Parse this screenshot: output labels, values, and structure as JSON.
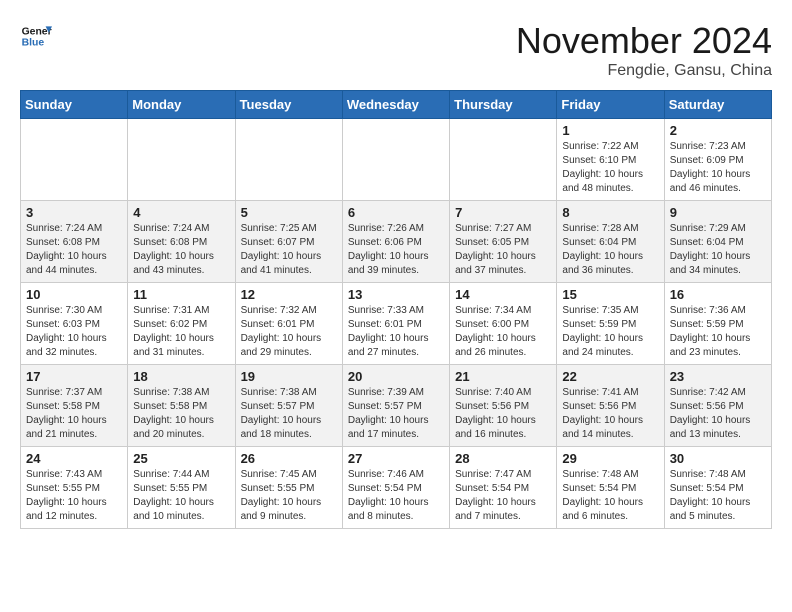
{
  "header": {
    "logo_line1": "General",
    "logo_line2": "Blue",
    "month": "November 2024",
    "location": "Fengdie, Gansu, China"
  },
  "weekdays": [
    "Sunday",
    "Monday",
    "Tuesday",
    "Wednesday",
    "Thursday",
    "Friday",
    "Saturday"
  ],
  "weeks": [
    [
      {
        "day": "",
        "info": ""
      },
      {
        "day": "",
        "info": ""
      },
      {
        "day": "",
        "info": ""
      },
      {
        "day": "",
        "info": ""
      },
      {
        "day": "",
        "info": ""
      },
      {
        "day": "1",
        "info": "Sunrise: 7:22 AM\nSunset: 6:10 PM\nDaylight: 10 hours\nand 48 minutes."
      },
      {
        "day": "2",
        "info": "Sunrise: 7:23 AM\nSunset: 6:09 PM\nDaylight: 10 hours\nand 46 minutes."
      }
    ],
    [
      {
        "day": "3",
        "info": "Sunrise: 7:24 AM\nSunset: 6:08 PM\nDaylight: 10 hours\nand 44 minutes."
      },
      {
        "day": "4",
        "info": "Sunrise: 7:24 AM\nSunset: 6:08 PM\nDaylight: 10 hours\nand 43 minutes."
      },
      {
        "day": "5",
        "info": "Sunrise: 7:25 AM\nSunset: 6:07 PM\nDaylight: 10 hours\nand 41 minutes."
      },
      {
        "day": "6",
        "info": "Sunrise: 7:26 AM\nSunset: 6:06 PM\nDaylight: 10 hours\nand 39 minutes."
      },
      {
        "day": "7",
        "info": "Sunrise: 7:27 AM\nSunset: 6:05 PM\nDaylight: 10 hours\nand 37 minutes."
      },
      {
        "day": "8",
        "info": "Sunrise: 7:28 AM\nSunset: 6:04 PM\nDaylight: 10 hours\nand 36 minutes."
      },
      {
        "day": "9",
        "info": "Sunrise: 7:29 AM\nSunset: 6:04 PM\nDaylight: 10 hours\nand 34 minutes."
      }
    ],
    [
      {
        "day": "10",
        "info": "Sunrise: 7:30 AM\nSunset: 6:03 PM\nDaylight: 10 hours\nand 32 minutes."
      },
      {
        "day": "11",
        "info": "Sunrise: 7:31 AM\nSunset: 6:02 PM\nDaylight: 10 hours\nand 31 minutes."
      },
      {
        "day": "12",
        "info": "Sunrise: 7:32 AM\nSunset: 6:01 PM\nDaylight: 10 hours\nand 29 minutes."
      },
      {
        "day": "13",
        "info": "Sunrise: 7:33 AM\nSunset: 6:01 PM\nDaylight: 10 hours\nand 27 minutes."
      },
      {
        "day": "14",
        "info": "Sunrise: 7:34 AM\nSunset: 6:00 PM\nDaylight: 10 hours\nand 26 minutes."
      },
      {
        "day": "15",
        "info": "Sunrise: 7:35 AM\nSunset: 5:59 PM\nDaylight: 10 hours\nand 24 minutes."
      },
      {
        "day": "16",
        "info": "Sunrise: 7:36 AM\nSunset: 5:59 PM\nDaylight: 10 hours\nand 23 minutes."
      }
    ],
    [
      {
        "day": "17",
        "info": "Sunrise: 7:37 AM\nSunset: 5:58 PM\nDaylight: 10 hours\nand 21 minutes."
      },
      {
        "day": "18",
        "info": "Sunrise: 7:38 AM\nSunset: 5:58 PM\nDaylight: 10 hours\nand 20 minutes."
      },
      {
        "day": "19",
        "info": "Sunrise: 7:38 AM\nSunset: 5:57 PM\nDaylight: 10 hours\nand 18 minutes."
      },
      {
        "day": "20",
        "info": "Sunrise: 7:39 AM\nSunset: 5:57 PM\nDaylight: 10 hours\nand 17 minutes."
      },
      {
        "day": "21",
        "info": "Sunrise: 7:40 AM\nSunset: 5:56 PM\nDaylight: 10 hours\nand 16 minutes."
      },
      {
        "day": "22",
        "info": "Sunrise: 7:41 AM\nSunset: 5:56 PM\nDaylight: 10 hours\nand 14 minutes."
      },
      {
        "day": "23",
        "info": "Sunrise: 7:42 AM\nSunset: 5:56 PM\nDaylight: 10 hours\nand 13 minutes."
      }
    ],
    [
      {
        "day": "24",
        "info": "Sunrise: 7:43 AM\nSunset: 5:55 PM\nDaylight: 10 hours\nand 12 minutes."
      },
      {
        "day": "25",
        "info": "Sunrise: 7:44 AM\nSunset: 5:55 PM\nDaylight: 10 hours\nand 10 minutes."
      },
      {
        "day": "26",
        "info": "Sunrise: 7:45 AM\nSunset: 5:55 PM\nDaylight: 10 hours\nand 9 minutes."
      },
      {
        "day": "27",
        "info": "Sunrise: 7:46 AM\nSunset: 5:54 PM\nDaylight: 10 hours\nand 8 minutes."
      },
      {
        "day": "28",
        "info": "Sunrise: 7:47 AM\nSunset: 5:54 PM\nDaylight: 10 hours\nand 7 minutes."
      },
      {
        "day": "29",
        "info": "Sunrise: 7:48 AM\nSunset: 5:54 PM\nDaylight: 10 hours\nand 6 minutes."
      },
      {
        "day": "30",
        "info": "Sunrise: 7:48 AM\nSunset: 5:54 PM\nDaylight: 10 hours\nand 5 minutes."
      }
    ]
  ]
}
